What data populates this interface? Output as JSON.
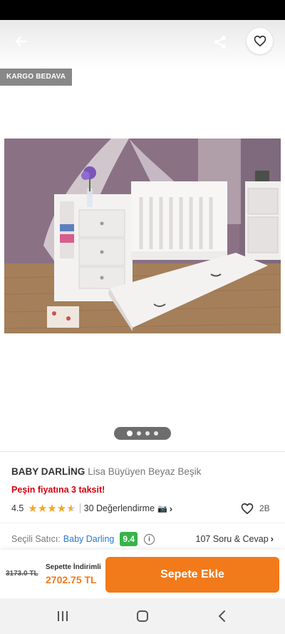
{
  "header": {
    "back_icon": "arrow-left-icon",
    "share_icon": "share-icon",
    "favorite_icon": "heart-outline-icon"
  },
  "hero": {
    "badge": "KARGO BEDAVA",
    "image_count": 4,
    "active_image": 1
  },
  "product": {
    "brand": "BABY DARLİNG",
    "name": "Lisa Büyüyen Beyaz Beşik",
    "installment": "Peşin fiyatına 3 taksit!",
    "rating": "4.5",
    "rating_stars": 4.5,
    "reviews": "30 Değerlendirme",
    "likes": "2B"
  },
  "seller": {
    "label": "Seçili Satıcı:",
    "name": "Baby Darling",
    "score": "9.4",
    "qa": "107 Soru & Cevap"
  },
  "cart": {
    "old_price": "3173.0 TL",
    "discount_label": "Sepette İndirimli",
    "new_price": "2702.75 TL",
    "button": "Sepete Ekle"
  },
  "colors": {
    "accent": "#f27a1a",
    "score_green": "#36b449",
    "installment_red": "#d4000f",
    "seller_link": "#2a7ad1",
    "star": "#f5a623"
  }
}
